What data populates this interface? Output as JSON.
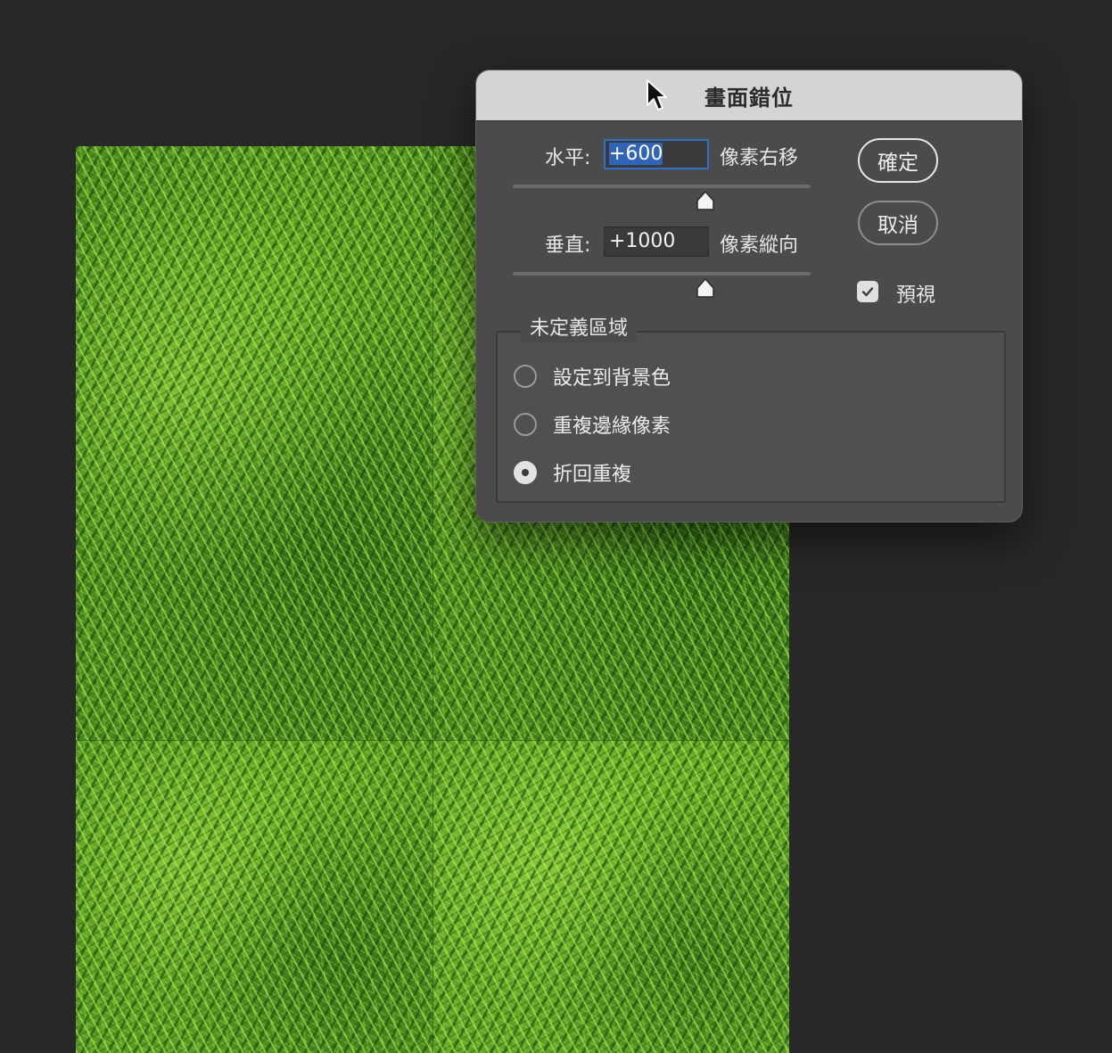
{
  "dialog": {
    "title": "畫面錯位",
    "horizontal": {
      "label": "水平:",
      "value": "+600",
      "unit": "像素右移"
    },
    "vertical": {
      "label": "垂直:",
      "value": "+1000",
      "unit": "像素縱向"
    },
    "ok_label": "確定",
    "cancel_label": "取消",
    "preview_label": "預視",
    "preview_checked": true,
    "undefined_area": {
      "legend": "未定義區域",
      "options": [
        {
          "label": "設定到背景色",
          "checked": false
        },
        {
          "label": "重複邊緣像素",
          "checked": false
        },
        {
          "label": "折回重複",
          "checked": true
        }
      ]
    }
  },
  "colors": {
    "workspace_bg": "#282828",
    "dialog_bg": "#4b4b4b",
    "titlebar_bg": "#d4d4d4",
    "selection": "#2f64b8"
  },
  "icons": {
    "cursor": "mouse-pointer-icon",
    "slider_thumb": "slider-thumb-icon",
    "checkmark": "checkmark-icon"
  }
}
